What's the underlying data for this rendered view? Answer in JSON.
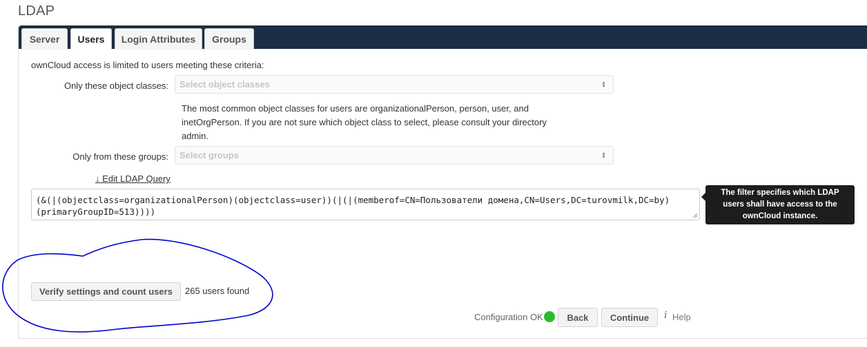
{
  "page_title": "LDAP",
  "tabs": [
    {
      "label": "Server"
    },
    {
      "label": "Users"
    },
    {
      "label": "Login Attributes"
    },
    {
      "label": "Groups"
    }
  ],
  "users_tab": {
    "intro": "ownCloud access is limited to users meeting these criteria:",
    "object_classes_label": "Only these object classes:",
    "object_classes_placeholder": "Select object classes",
    "object_classes_hint": "The most common object classes for users are organizationalPerson, person, user, and inetOrgPerson. If you are not sure which object class to select, please consult your directory admin.",
    "groups_label": "Only from these groups:",
    "groups_placeholder": "Select groups",
    "edit_query_link": "↓ Edit LDAP Query",
    "ldap_query": "(&(|(objectclass=organizationalPerson)(objectclass=user))(|(|(memberof=CN=Пользователи домена,CN=Users,DC=turovmilk,DC=by)(primaryGroupID=513))))",
    "query_tooltip": "The filter specifies which LDAP users shall have access to the ownCloud instance.",
    "verify_button": "Verify settings and count users",
    "users_found": "265 users found"
  },
  "footer": {
    "config_status": "Configuration OK",
    "status_color": "#2dbb2d",
    "back_button": "Back",
    "continue_button": "Continue",
    "help_icon": "i",
    "help_label": "Help"
  },
  "colors": {
    "tabbar": "#1d2d44",
    "annotation_stroke": "#0000cc"
  }
}
